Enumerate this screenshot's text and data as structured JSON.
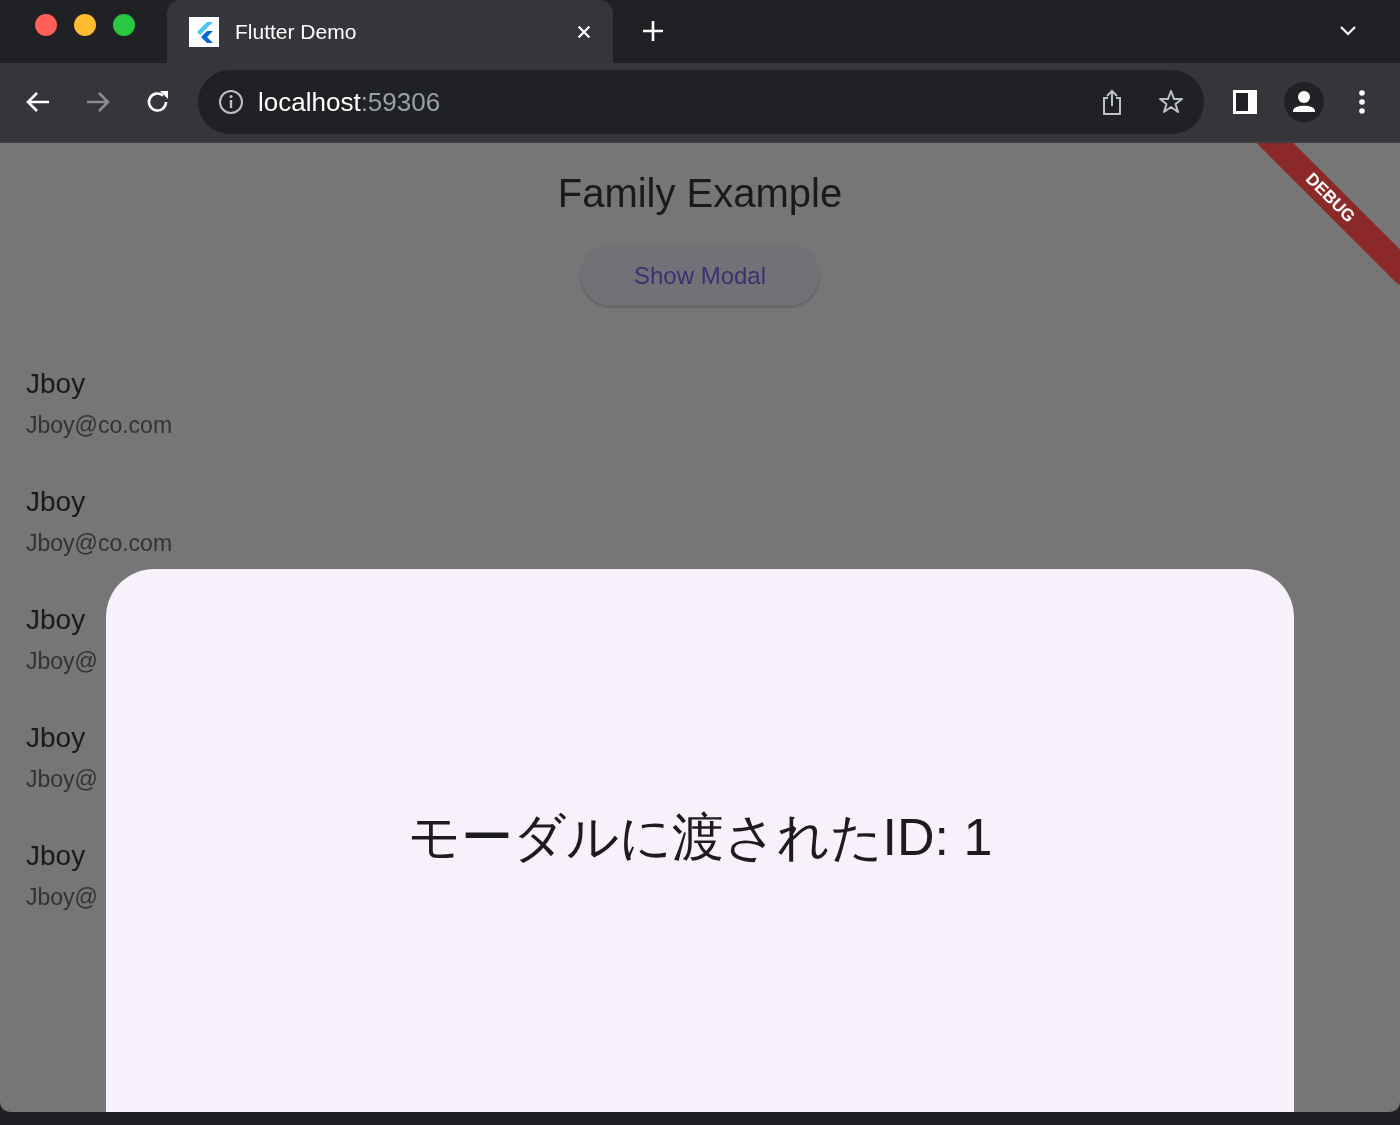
{
  "browser": {
    "tab": {
      "title": "Flutter Demo",
      "selected": true
    },
    "address": {
      "host": "localhost",
      "port": ":59306"
    }
  },
  "app": {
    "title": "Family Example",
    "button": "Show Modal",
    "banner": "DEBUG",
    "people": [
      {
        "name": "Jboy",
        "email": "Jboy@co.com"
      },
      {
        "name": "Jboy",
        "email": "Jboy@co.com"
      },
      {
        "name": "Jboy",
        "email": "Jboy@"
      },
      {
        "name": "Jboy",
        "email": "Jboy@"
      },
      {
        "name": "Jboy",
        "email": "Jboy@"
      }
    ]
  },
  "modal": {
    "text": "モーダルに渡されたID: 1"
  }
}
